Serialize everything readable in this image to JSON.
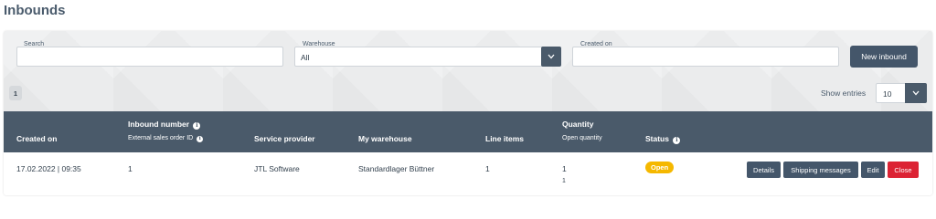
{
  "page": {
    "title": "Inbounds"
  },
  "filters": {
    "search_label": "Search",
    "search_value": "",
    "warehouse_label": "Warehouse",
    "warehouse_value": "All",
    "created_on_label": "Created on",
    "created_on_value": "",
    "new_button": "New inbound"
  },
  "pagination": {
    "current_page": "1",
    "show_entries_label": "Show entries",
    "entries_value": "10"
  },
  "table": {
    "headers": {
      "created_on": "Created on",
      "inbound_number": "Inbound number",
      "external_order": "External sales order ID",
      "service_provider": "Service provider",
      "my_warehouse": "My warehouse",
      "line_items": "Line items",
      "quantity": "Quantity",
      "open_quantity": "Open quantity",
      "status": "Status"
    },
    "rows": [
      {
        "created_on": "17.02.2022 | 09:35",
        "inbound_number": "1",
        "service_provider": "JTL Software",
        "my_warehouse": "Standardlager Büttner",
        "line_items": "1",
        "quantity": "1",
        "open_quantity": "1",
        "status": "Open",
        "actions": [
          "Details",
          "Shipping messages",
          "Edit",
          "Close"
        ]
      }
    ]
  },
  "colors": {
    "header_bg": "#4a5a6a",
    "primary_button": "#44566a",
    "status_open": "#f5b800",
    "danger": "#dc2334"
  },
  "icons": [
    "info-icon",
    "chevron-down-icon"
  ]
}
